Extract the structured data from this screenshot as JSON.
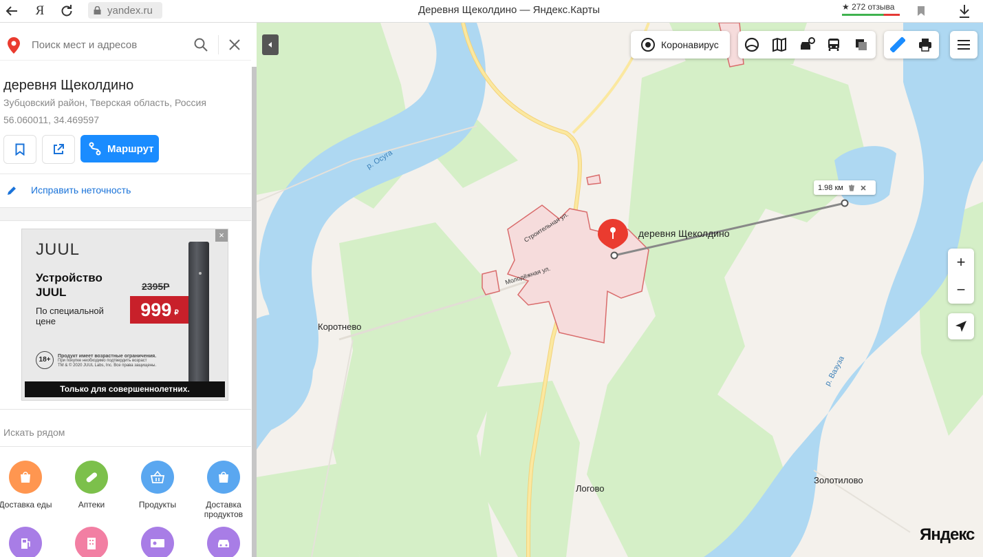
{
  "browser": {
    "url": "yandex.ru",
    "title": "Деревня Щеколдино — Яндекс.Карты",
    "reviews": "★ 272 отзыва"
  },
  "sidebar": {
    "search_placeholder": "Поиск мест и адресов",
    "place": {
      "title": "деревня Щеколдино",
      "subtitle": "Зубцовский район, Тверская область, Россия",
      "coords": "56.060011, 34.469597"
    },
    "route_label": "Маршрут",
    "fix_label": "Исправить неточность",
    "ad": {
      "brand": "JUUL",
      "headline": "Устройство JUUL",
      "subline": "По специальной цене",
      "old_price": "2395Р",
      "price": "999",
      "currency": "₽",
      "age": "18+",
      "legal_bold": "Продукт имеет возрастные ограничения.",
      "legal_1": "При покупке необходимо подтвердить возраст",
      "legal_2": "ТМ & © 2020 JUUL Labs, Inc. Все права защищены.",
      "footer": "Только для совершеннолетних.",
      "close": "×"
    },
    "nearby_label": "Искать рядом",
    "categories": [
      {
        "label": "Доставка еды",
        "icon": "shopping-bag-icon",
        "color": "#ff9650"
      },
      {
        "label": "Аптеки",
        "icon": "pill-icon",
        "color": "#7cc04b"
      },
      {
        "label": "Продукты",
        "icon": "basket-icon",
        "color": "#5aa7f0"
      },
      {
        "label": "Доставка продуктов",
        "icon": "shopping-bag-icon",
        "color": "#5aa7f0"
      },
      {
        "label": "",
        "icon": "fuel-icon",
        "color": "#a87de6"
      },
      {
        "label": "",
        "icon": "hotel-icon",
        "color": "#f27fa3"
      },
      {
        "label": "",
        "icon": "atm-icon",
        "color": "#a87de6"
      },
      {
        "label": "",
        "icon": "car-service-icon",
        "color": "#a87de6"
      }
    ]
  },
  "map": {
    "covid_label": "Коронавирус",
    "selected_label": "деревня Щеколдино",
    "ruler_distance": "1.98 км",
    "labels": {
      "river_osuga": "р. Осуга",
      "river_vazuza": "р. Вазуза",
      "street_stroitelnaya": "Строительная ул.",
      "street_molodezhnaya": "Молодёжная ул.",
      "korotnevo": "Коротнево",
      "logovo": "Логово",
      "zolotilovo": "Золотилово"
    },
    "zoom_in": "+",
    "zoom_out": "−",
    "logo": "Яндекс",
    "colors": {
      "water": "#aed8f2",
      "forest": "#d5efc7",
      "settlement": "#f6dcdc",
      "settlement_border": "#d96b6b",
      "road": "#fbe8a0",
      "pin": "#ea3b2f"
    }
  }
}
